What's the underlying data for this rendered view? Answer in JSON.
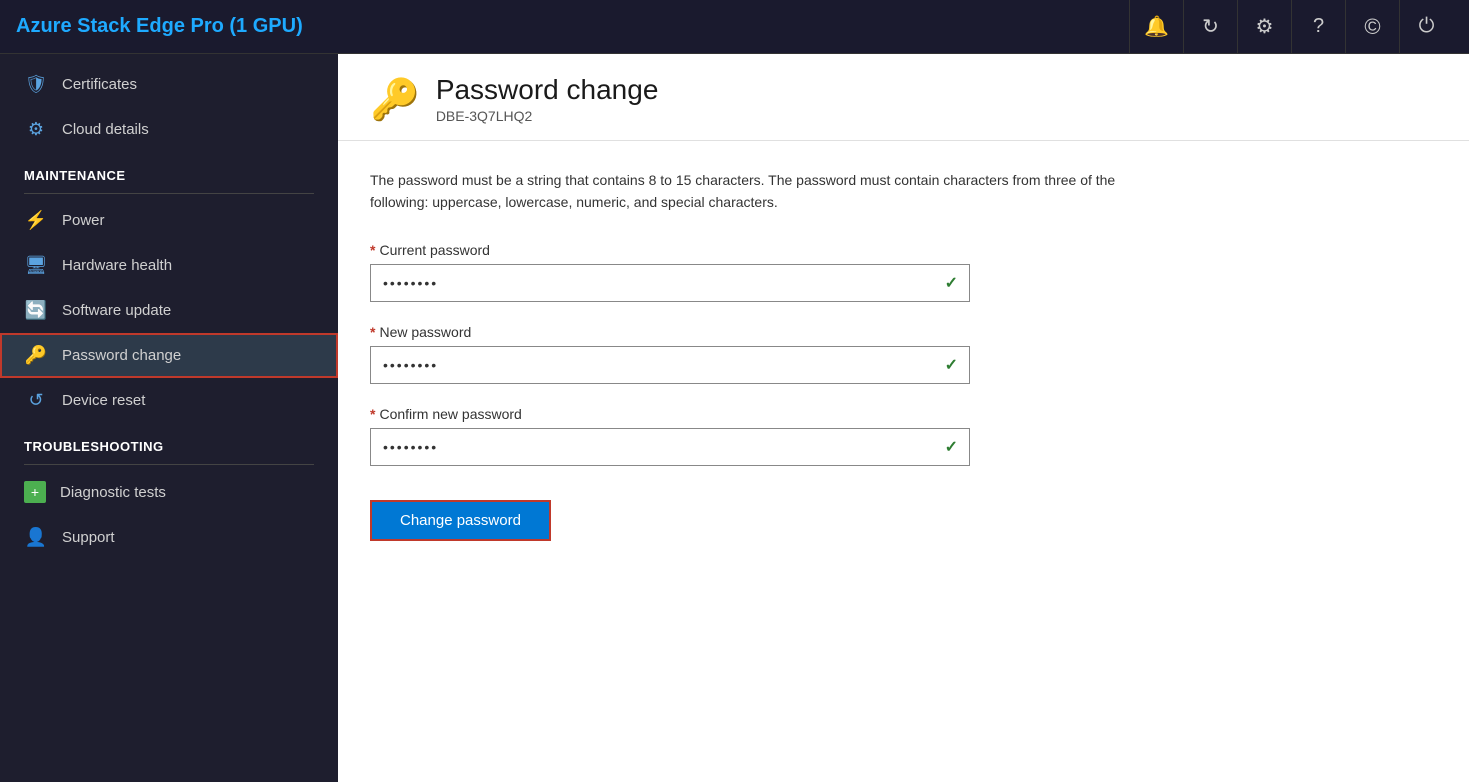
{
  "app": {
    "title": "Azure Stack Edge Pro (1 GPU)"
  },
  "header_icons": [
    {
      "name": "bell-icon",
      "symbol": "🔔"
    },
    {
      "name": "refresh-icon",
      "symbol": "↻"
    },
    {
      "name": "settings-icon",
      "symbol": "⚙"
    },
    {
      "name": "help-icon",
      "symbol": "?"
    },
    {
      "name": "copyright-icon",
      "symbol": "©"
    },
    {
      "name": "power-icon",
      "symbol": "⏻"
    }
  ],
  "sidebar": {
    "top_items": [
      {
        "id": "certificates",
        "label": "Certificates",
        "icon": "🛡",
        "icon_class": "icon-certificates"
      },
      {
        "id": "cloud-details",
        "label": "Cloud details",
        "icon": "⚙",
        "icon_class": "icon-cloud"
      }
    ],
    "maintenance_section": "MAINTENANCE",
    "maintenance_items": [
      {
        "id": "power",
        "label": "Power",
        "icon": "⚡",
        "icon_class": "icon-power"
      },
      {
        "id": "hardware-health",
        "label": "Hardware health",
        "icon": "🖥",
        "icon_class": "icon-hardware"
      },
      {
        "id": "software-update",
        "label": "Software update",
        "icon": "🔄",
        "icon_class": "icon-software"
      },
      {
        "id": "password-change",
        "label": "Password change",
        "icon": "🔑",
        "icon_class": "icon-password",
        "active": true
      },
      {
        "id": "device-reset",
        "label": "Device reset",
        "icon": "↺",
        "icon_class": "icon-reset"
      }
    ],
    "troubleshooting_section": "TROUBLESHOOTING",
    "troubleshooting_items": [
      {
        "id": "diagnostic-tests",
        "label": "Diagnostic tests",
        "icon": "➕",
        "icon_class": "icon-diagnostic"
      },
      {
        "id": "support",
        "label": "Support",
        "icon": "👤",
        "icon_class": "icon-support"
      }
    ]
  },
  "page": {
    "icon": "🔑",
    "title": "Password change",
    "subtitle": "DBE-3Q7LHQ2",
    "description": "The password must be a string that contains 8 to 15 characters. The password must contain characters from three of the following: uppercase, lowercase, numeric, and special characters.",
    "fields": [
      {
        "id": "current-password",
        "label": "Current password",
        "required": true,
        "value": "••••••••",
        "valid": true
      },
      {
        "id": "new-password",
        "label": "New password",
        "required": true,
        "value": "••••••••",
        "valid": true
      },
      {
        "id": "confirm-password",
        "label": "Confirm new password",
        "required": true,
        "value": "••••••••",
        "valid": true
      }
    ],
    "submit_button": "Change password",
    "required_symbol": "*",
    "checkmark": "✓"
  }
}
